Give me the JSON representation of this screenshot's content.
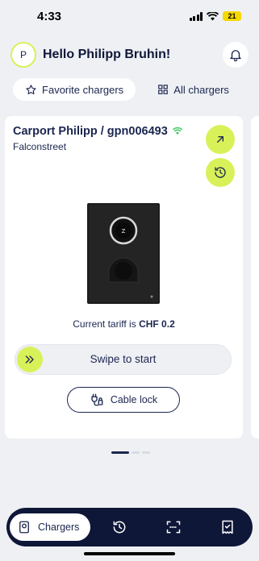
{
  "status_bar": {
    "time": "4:33",
    "battery": "21"
  },
  "header": {
    "avatar_initial": "P",
    "greeting": "Hello Philipp Bruhin!"
  },
  "tabs": [
    {
      "label": "Favorite chargers",
      "icon": "star-icon",
      "active": true
    },
    {
      "label": "All chargers",
      "icon": "grid-icon",
      "active": false
    }
  ],
  "charger_card": {
    "title": "Carport Philipp / gpn006493",
    "location": "Falconstreet",
    "connection_icon": "wifi-icon",
    "tariff_label": "Current tariff is",
    "tariff_value": "CHF 0.2",
    "swipe_label": "Swipe to start",
    "cable_lock_label": "Cable lock"
  },
  "pager": {
    "pages": 3,
    "active_index": 0
  },
  "bottom_nav": {
    "items": [
      {
        "label": "Chargers",
        "icon": "charger-icon",
        "active": true
      },
      {
        "label": "",
        "icon": "history-icon",
        "active": false
      },
      {
        "label": "",
        "icon": "scan-icon",
        "active": false
      },
      {
        "label": "",
        "icon": "receipt-icon",
        "active": false
      }
    ]
  },
  "colors": {
    "accent": "#d9f159",
    "navy": "#0f1738",
    "text": "#1b2650",
    "background": "#eef0f4",
    "wifi": "#35c759"
  }
}
